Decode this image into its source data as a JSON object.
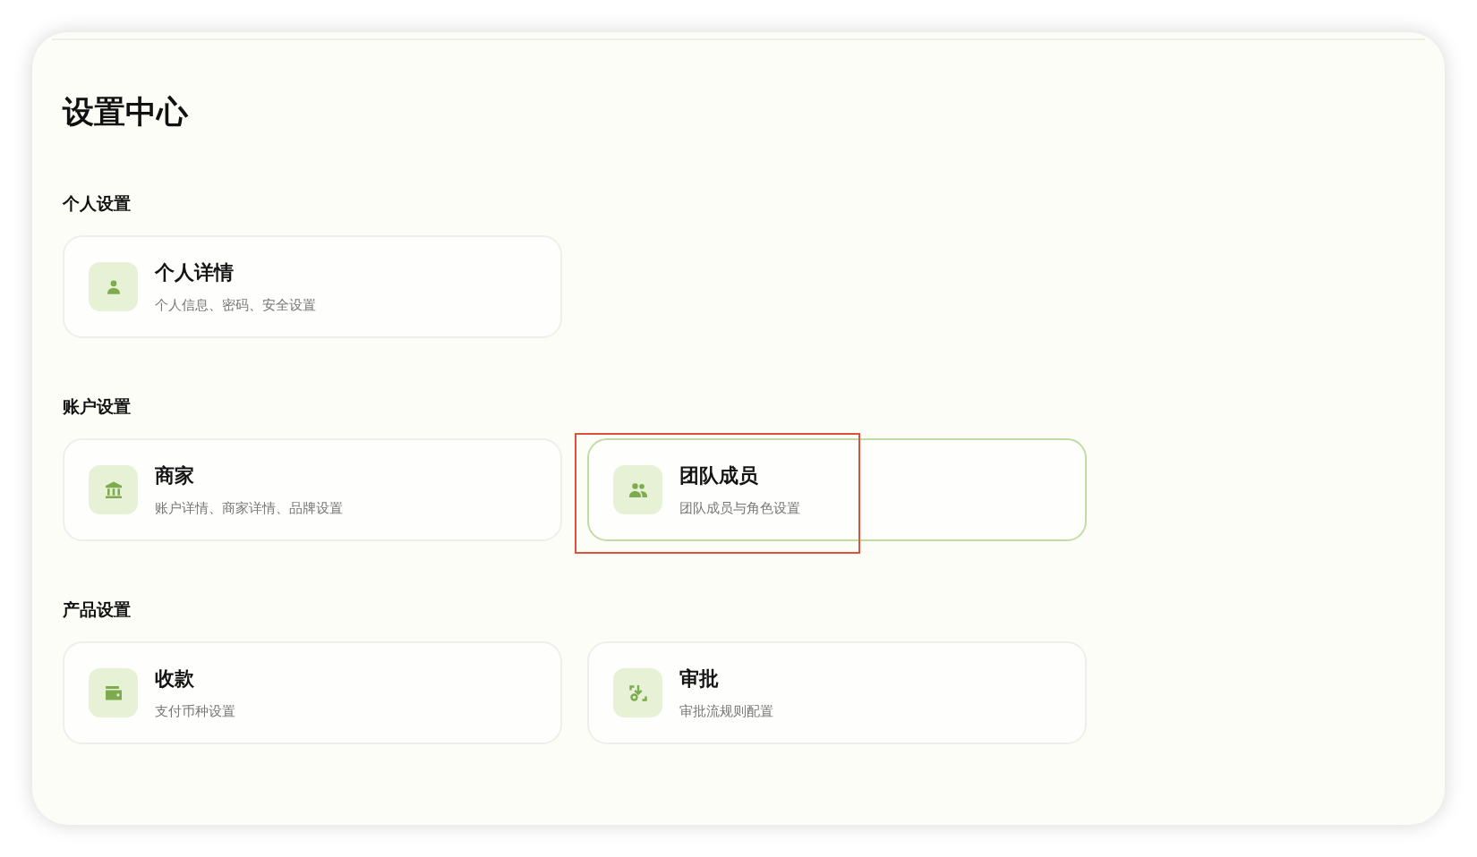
{
  "page": {
    "title": "设置中心"
  },
  "sections": [
    {
      "title": "个人设置",
      "items": [
        {
          "title": "个人详情",
          "description": "个人信息、密码、安全设置",
          "selected": false,
          "highlighted": false
        }
      ]
    },
    {
      "title": "账户设置",
      "items": [
        {
          "title": "商家",
          "description": "账户详情、商家详情、品牌设置",
          "selected": false,
          "highlighted": false
        },
        {
          "title": "团队成员",
          "description": "团队成员与角色设置",
          "selected": true,
          "highlighted": true
        }
      ]
    },
    {
      "title": "产品设置",
      "items": [
        {
          "title": "收款",
          "description": "支付币种设置",
          "selected": false,
          "highlighted": false
        },
        {
          "title": "审批",
          "description": "审批流规则配置",
          "selected": false,
          "highlighted": false
        }
      ]
    }
  ]
}
